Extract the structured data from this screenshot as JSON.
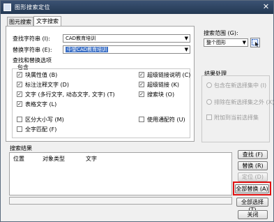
{
  "window": {
    "title": "图形搜索定位",
    "close_glyph": "✕"
  },
  "tabs": [
    {
      "label": "图元搜索",
      "active": false
    },
    {
      "label": "文字搜索",
      "active": true
    }
  ],
  "find": {
    "label": "查找字符串 (I):",
    "value": "CAD教育培训"
  },
  "replace": {
    "label": "替换字符串 (E):",
    "value": "中望CAD教育培训"
  },
  "options": {
    "title": "查找和替换选项",
    "include_label": "包含",
    "left_checks": [
      {
        "label": "块属性值 (B)",
        "checked": true
      },
      {
        "label": "标注注释文字 (D)",
        "checked": true
      },
      {
        "label": "文字 (多行文字, 动态文字, 文字) (T)",
        "checked": true
      },
      {
        "label": "表格文字 (L)",
        "checked": true
      }
    ],
    "right_checks": [
      {
        "label": "超级链接说明 (C)",
        "checked": true
      },
      {
        "label": "超级链接 (K)",
        "checked": true
      },
      {
        "label": "搜索块 (O)",
        "checked": true
      }
    ],
    "bottom_checks": [
      {
        "label": "区分大小写 (M)",
        "checked": false
      },
      {
        "label": "全字匹配 (F)",
        "checked": false
      },
      {
        "label": "使用通配符 (U)",
        "checked": false
      }
    ]
  },
  "search_scope": {
    "label": "搜索范围 (G):",
    "value": "整个图形"
  },
  "result_processing": {
    "title": "结果处理",
    "options": [
      "包含在新选择集中 (I)",
      "排除在新选择集之外 (X)",
      "附加到当前选择集"
    ]
  },
  "results": {
    "title": "搜索结果",
    "columns": [
      "位置",
      "对象类型",
      "文字"
    ]
  },
  "buttons": {
    "find": "查找 (F)",
    "replace": "替换 (R)",
    "locate": "定位 (D)",
    "replace_all": "全部替换 (A)",
    "select_all": "全部选择 (T)",
    "close": "关闭"
  }
}
